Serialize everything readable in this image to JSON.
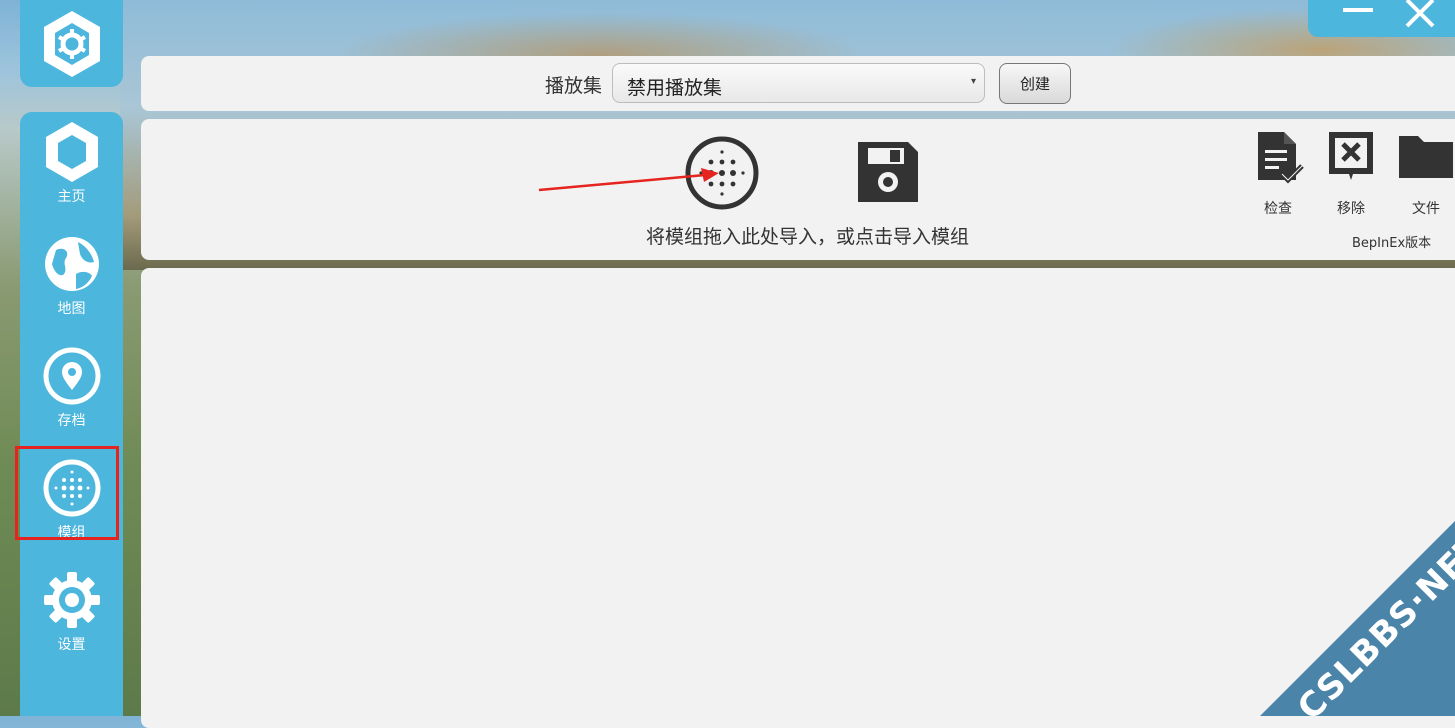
{
  "nav": {
    "items": [
      {
        "label": "主页",
        "icon": "hexagon-home-icon"
      },
      {
        "label": "地图",
        "icon": "globe-icon"
      },
      {
        "label": "存档",
        "icon": "location-pin-icon"
      },
      {
        "label": "模组",
        "icon": "mods-dots-icon"
      },
      {
        "label": "设置",
        "icon": "gear-icon"
      }
    ],
    "active": "模组"
  },
  "playset": {
    "label": "播放集",
    "selected": "禁用播放集",
    "create_label": "创建"
  },
  "import": {
    "hint": "将模组拖入此处导入，或点击导入模组"
  },
  "tools": [
    {
      "label": "检查",
      "icon": "document-check-icon"
    },
    {
      "label": "移除",
      "icon": "remove-box-icon"
    },
    {
      "label": "文件",
      "icon": "folder-icon"
    }
  ],
  "version_label": "BepInEx版本",
  "watermark": "CSLBBS·NET",
  "colors": {
    "accent": "#4cb6dc",
    "highlight": "#e5241f",
    "panel": "#f2f2f2"
  }
}
